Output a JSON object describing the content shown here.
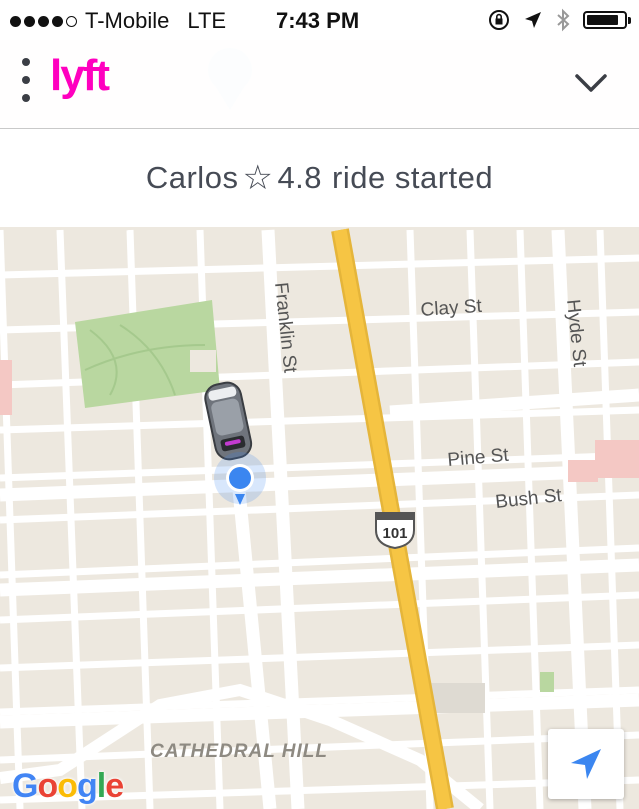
{
  "status_bar": {
    "carrier": "T-Mobile",
    "network": "LTE",
    "time": "7:43 PM",
    "signal_bars_filled": 4,
    "signal_bars_total": 5,
    "battery_level": 0.85,
    "icons": [
      "orientation-lock-icon",
      "location-arrow-icon",
      "bluetooth-icon",
      "battery-icon"
    ]
  },
  "header": {
    "logo_text": "lyft",
    "logo_color": "#ff00bf",
    "menu_icon": "vertical-dots-icon",
    "collapse_icon": "chevron-down-icon"
  },
  "ride_banner": {
    "driver_name": "Carlos",
    "rating_icon": "☆",
    "rating": "4.8",
    "status": "ride started"
  },
  "map": {
    "streets": {
      "clay": "Clay St",
      "hyde": "Hyde St",
      "franklin": "Franklin St",
      "pine": "Pine St",
      "bush": "Bush St"
    },
    "highway_shield": "101",
    "neighborhood": "CATHEDRAL HILL",
    "attribution": {
      "letters": [
        "G",
        "o",
        "o",
        "g",
        "l",
        "e"
      ],
      "colors": [
        "#4285f4",
        "#ea4335",
        "#fbbc05",
        "#4285f4",
        "#34a853",
        "#ea4335"
      ]
    },
    "locate_icon": "navigation-arrow-icon",
    "colors": {
      "land": "#ede8df",
      "street": "#ffffff",
      "highway": "#f6c544",
      "park": "#b9d7a0",
      "user_dot": "#3b86f0"
    }
  }
}
